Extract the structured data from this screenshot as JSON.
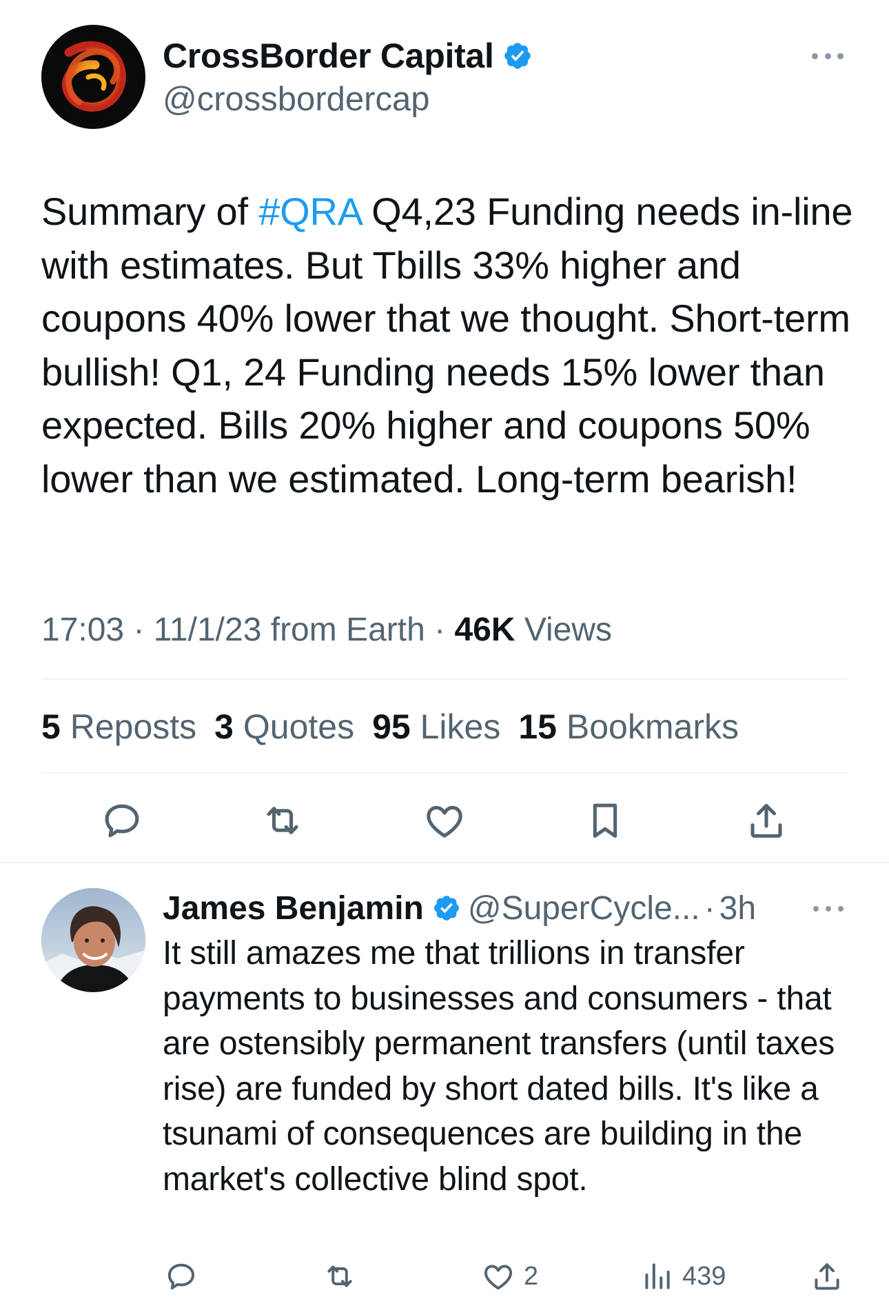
{
  "main_tweet": {
    "author_name": "CrossBorder Capital",
    "author_handle": "@crossbordercap",
    "text_before_tag": "Summary of ",
    "hashtag": "#QRA",
    "text_after_tag": " Q4,23 Funding needs in-line with estimates. But Tbills 33% higher and coupons 40% lower that we thought. Short-term bullish! Q1, 24 Funding needs 15% lower than expected. Bills 20% higher and coupons 50% lower than we estimated. Long-term bearish!",
    "time": "17:03",
    "date": "11/1/23",
    "source": "from Earth",
    "views_count": "46K",
    "views_label": "Views",
    "stats": [
      {
        "count": "5",
        "label": "Reposts"
      },
      {
        "count": "3",
        "label": "Quotes"
      },
      {
        "count": "95",
        "label": "Likes"
      },
      {
        "count": "15",
        "label": "Bookmarks"
      }
    ],
    "actions": [
      "reply-icon",
      "repost-icon",
      "like-icon",
      "bookmark-icon",
      "share-icon"
    ]
  },
  "reply": {
    "author_name": "James Benjamin",
    "author_handle": "@SuperCycle...",
    "separator": "·",
    "age": "3h",
    "text": "It still amazes me that trillions in transfer payments to businesses and consumers - that are ostensibly permanent transfers (until taxes rise) are funded by short dated bills. It's like a tsunami of consequences are building in the market's collective blind spot.",
    "likes": "2",
    "views": "439"
  },
  "colors": {
    "accent": "#1d9bf0",
    "text_primary": "#0f1419",
    "text_secondary": "#536471",
    "divider": "#eff3f4"
  }
}
